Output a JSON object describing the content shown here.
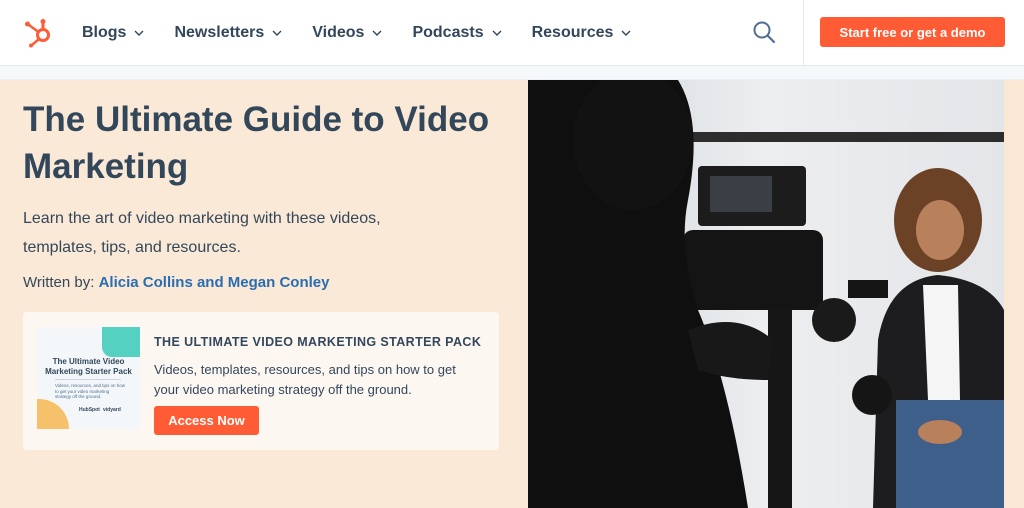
{
  "header": {
    "logo_name": "hubspot-sprocket-icon",
    "nav": [
      {
        "label": "Blogs"
      },
      {
        "label": "Newsletters"
      },
      {
        "label": "Videos"
      },
      {
        "label": "Podcasts"
      },
      {
        "label": "Resources"
      }
    ],
    "cta_label": "Start free or get a demo"
  },
  "hero": {
    "title": "The Ultimate Guide to Video Marketing",
    "subtitle": "Learn the art of video marketing with these videos, templates, tips, and resources.",
    "byline_prefix": "Written by:",
    "authors": "Alicia Collins and Megan Conley"
  },
  "offer": {
    "thumbnail": {
      "title": "The Ultimate Video Marketing Starter Pack",
      "subtitle": "Videos, resources, and tips on how to get your video marketing strategy off the ground.",
      "logo_a": "HubSpot",
      "logo_b": "vidyard"
    },
    "heading": "THE ULTIMATE VIDEO MARKETING STARTER PACK",
    "text": "Videos, templates, resources, and tips on how to get your video marketing strategy off the ground.",
    "button_label": "Access Now"
  },
  "colors": {
    "brand_orange": "#ff5c35",
    "text_dark": "#33475b",
    "link_blue": "#2a6db0",
    "hero_bg": "#fae9d6"
  }
}
